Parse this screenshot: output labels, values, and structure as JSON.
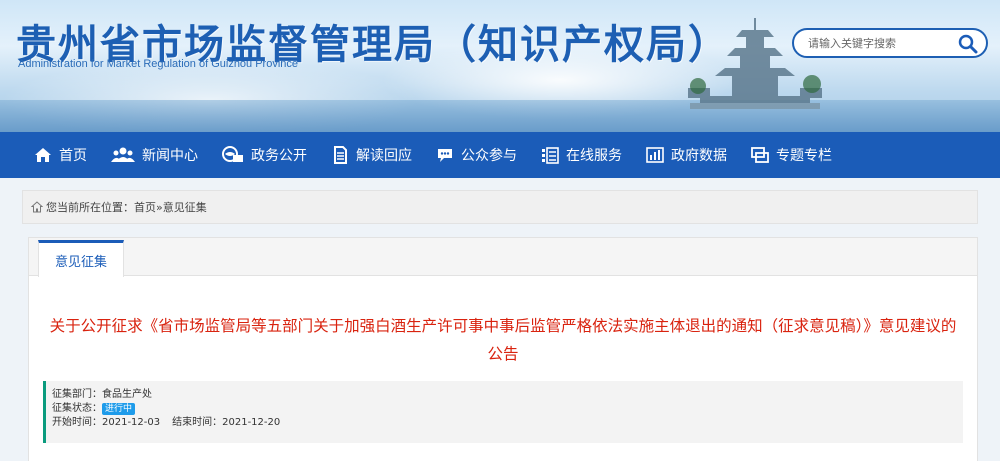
{
  "header": {
    "title": "贵州省市场监督管理局（知识产权局）",
    "subtitle": "Administration for Market Regulation of Guizhou Province",
    "search_placeholder": "请输入关键字搜索"
  },
  "nav": {
    "items": [
      {
        "label": "首页",
        "icon": "home-icon"
      },
      {
        "label": "新闻中心",
        "icon": "people-icon"
      },
      {
        "label": "政务公开",
        "icon": "monitor-icon"
      },
      {
        "label": "解读回应",
        "icon": "document-icon"
      },
      {
        "label": "公众参与",
        "icon": "chat-icon"
      },
      {
        "label": "在线服务",
        "icon": "list-icon"
      },
      {
        "label": "政府数据",
        "icon": "bar-chart-icon"
      },
      {
        "label": "专题专栏",
        "icon": "window-icon"
      }
    ]
  },
  "breadcrumb": {
    "prefix": "您当前所在位置：",
    "home": "首页",
    "separator": " » ",
    "current": "意见征集"
  },
  "tab": {
    "label": "意见征集"
  },
  "article": {
    "title": "关于公开征求《省市场监管局等五部门关于加强白酒生产许可事中事后监管严格依法实施主体退出的通知（征求意见稿）》意见建议的公告"
  },
  "info": {
    "dept_label": "征集部门：",
    "dept_value": "食品生产处",
    "status_label": "征集状态：",
    "status_value": "进行中",
    "start_label": "开始时间：",
    "start_value": "2021-12-03",
    "end_label": "结束时间：",
    "end_value": "2021-12-20"
  },
  "colors": {
    "brand_blue": "#1b5cb8",
    "title_red": "#d9230f",
    "status_blue": "#1e9bea",
    "accent_green": "#0a9b7e"
  }
}
